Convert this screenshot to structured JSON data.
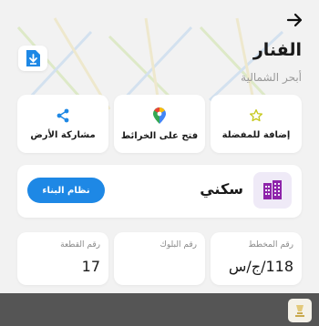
{
  "header": {
    "title": "الفنار",
    "subtitle": "أبحر الشمالية"
  },
  "actions": [
    {
      "label": "إضافة للمفضلة",
      "icon": "star-icon"
    },
    {
      "label": "فتح على الخرائط",
      "icon": "map-pin-icon"
    },
    {
      "label": "مشاركة الأرض",
      "icon": "share-icon"
    }
  ],
  "usage": {
    "label": "سكني",
    "icon": "building-icon",
    "system_button": "نظام البناء"
  },
  "info": [
    {
      "label": "رقم المخطط",
      "value": "118/ج/س"
    },
    {
      "label": "رقم البلوك",
      "value": ""
    },
    {
      "label": "رقم القطعة",
      "value": "17"
    }
  ],
  "colors": {
    "accent": "#1e88e5",
    "background": "#f2f2f2",
    "usage_icon": "#8e24aa",
    "star": "#c6c91e"
  }
}
